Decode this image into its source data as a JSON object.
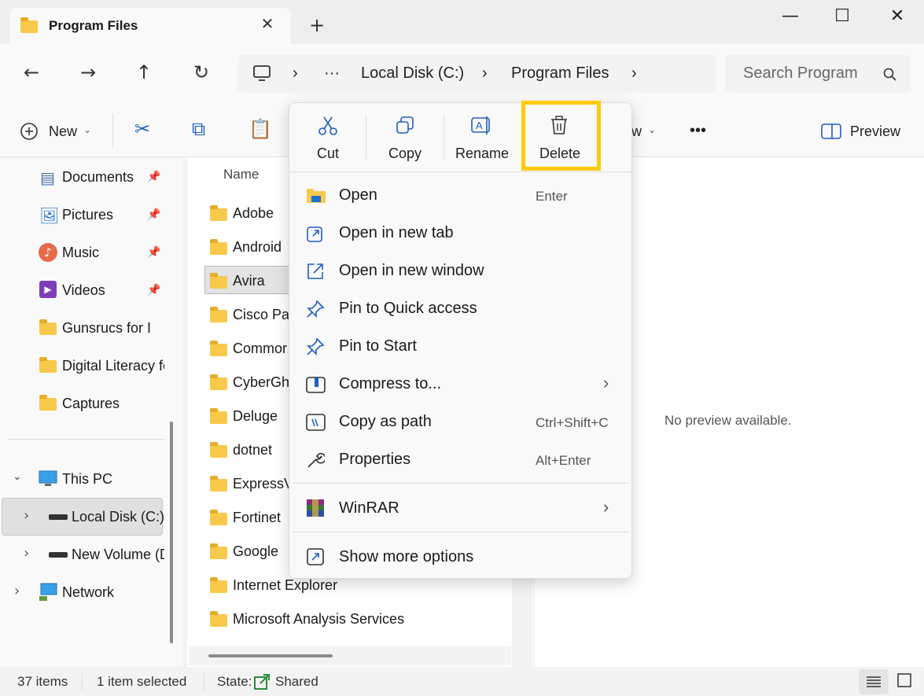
{
  "tab": {
    "title": "Program Files",
    "close": "✕",
    "new_tab": "+"
  },
  "window": {
    "minimize": "—",
    "maximize": "☐",
    "close": "✕"
  },
  "nav": {
    "back": "←",
    "forward": "→",
    "up": "↑",
    "refresh": "↻"
  },
  "address": {
    "more": "···",
    "crumbs": [
      "Local Disk (C:)",
      "Program Files"
    ],
    "chev": "›"
  },
  "search": {
    "placeholder": "Search Program"
  },
  "toolbar": {
    "new_label": "New",
    "view_label": "w",
    "more": "•••",
    "preview_label": "Preview"
  },
  "sidebar": {
    "pinned": [
      {
        "label": "Documents"
      },
      {
        "label": "Pictures"
      },
      {
        "label": "Music"
      },
      {
        "label": "Videos"
      }
    ],
    "folders": [
      {
        "label": "Gunsrucs for I"
      },
      {
        "label": "Digital Literacy fo"
      },
      {
        "label": "Captures"
      }
    ],
    "tree": [
      {
        "label": "This PC"
      },
      {
        "label": "Local Disk (C:)"
      },
      {
        "label": "New Volume (D"
      },
      {
        "label": "Network"
      }
    ]
  },
  "list": {
    "header": "Name",
    "items": [
      "Adobe",
      "Android",
      "Avira",
      "Cisco Pac",
      "Commor",
      "CyberGh",
      "Deluge",
      "dotnet",
      "ExpressV",
      "Fortinet",
      "Google",
      "Internet Explorer",
      "Microsoft Analysis Services"
    ]
  },
  "preview": {
    "empty": "No preview available."
  },
  "status": {
    "count": "37 items",
    "selected": "1 item selected",
    "state_label": "State:",
    "state_value": "Shared"
  },
  "context_menu": {
    "quick_actions": [
      {
        "label": "Cut",
        "icon": "✂"
      },
      {
        "label": "Copy",
        "icon": "⧉"
      },
      {
        "label": "Rename",
        "icon": "Ⓐ"
      },
      {
        "label": "Delete",
        "icon": "🗑"
      }
    ],
    "items": [
      {
        "label": "Open",
        "shortcut": "Enter",
        "icon": "▬"
      },
      {
        "label": "Open in new tab",
        "shortcut": "",
        "icon": "⧉"
      },
      {
        "label": "Open in new window",
        "shortcut": "",
        "icon": "↗"
      },
      {
        "label": "Pin to Quick access",
        "shortcut": "",
        "icon": "📌"
      },
      {
        "label": "Pin to Start",
        "shortcut": "",
        "icon": "📌"
      },
      {
        "label": "Compress to...",
        "shortcut": "›",
        "icon": "▣"
      },
      {
        "label": "Copy as path",
        "shortcut": "Ctrl+Shift+C",
        "icon": "⌸"
      },
      {
        "label": "Properties",
        "shortcut": "Alt+Enter",
        "icon": "🔧"
      }
    ],
    "winrar": {
      "label": "WinRAR",
      "arrow": "›"
    },
    "more_options": {
      "label": "Show more options",
      "icon": "⇱"
    }
  },
  "colors": {
    "highlight": "#ffcc00",
    "accent": "#1f5fbf",
    "folder": "#f8c94b"
  }
}
